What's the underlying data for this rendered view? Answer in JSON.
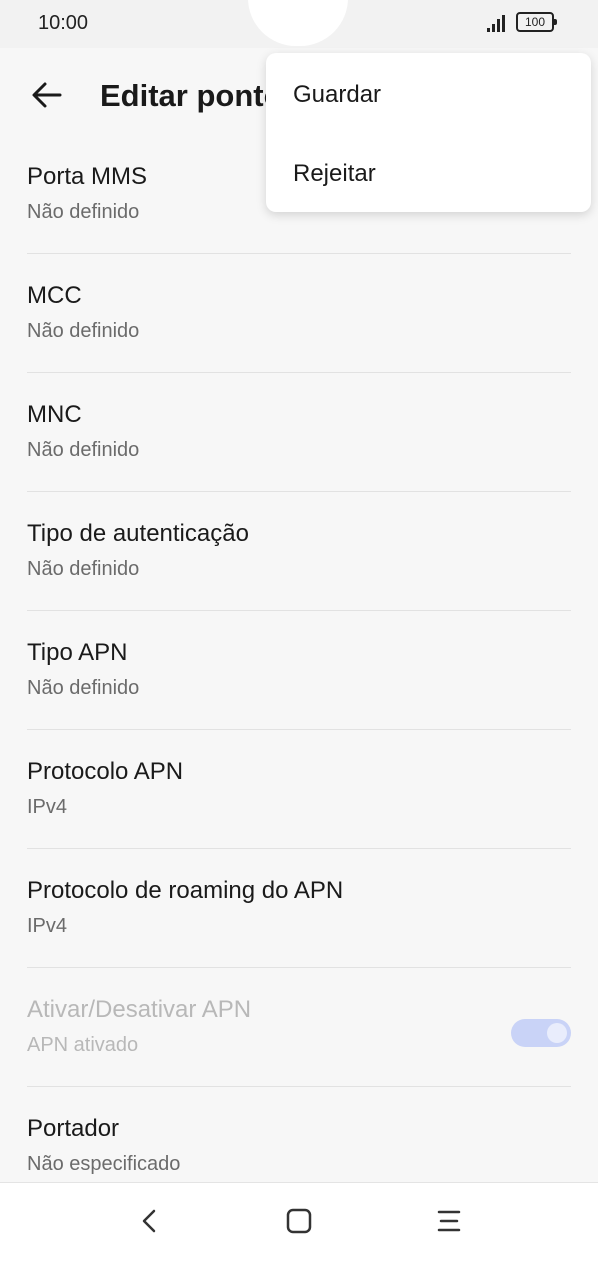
{
  "status_bar": {
    "time": "10:00",
    "battery": "100",
    "signal_icon": "signal-icon",
    "battery_icon": "battery-icon"
  },
  "app_bar": {
    "back_icon": "arrow-left-icon",
    "title": "Editar ponto de acesso"
  },
  "settings": [
    {
      "title": "Porta MMS",
      "value": "Não definido"
    },
    {
      "title": "MCC",
      "value": "Não definido"
    },
    {
      "title": "MNC",
      "value": "Não definido"
    },
    {
      "title": "Tipo de autenticação",
      "value": "Não definido"
    },
    {
      "title": "Tipo APN",
      "value": "Não definido"
    },
    {
      "title": "Protocolo APN",
      "value": "IPv4"
    },
    {
      "title": "Protocolo de roaming do APN",
      "value": "IPv4"
    },
    {
      "title": "Ativar/Desativar APN",
      "value": "APN ativado",
      "toggle": true,
      "toggle_on": true,
      "disabled": true
    },
    {
      "title": "Portador",
      "value": "Não especificado"
    }
  ],
  "overflow_menu": {
    "items": [
      "Guardar",
      "Rejeitar"
    ]
  },
  "nav_bar": {
    "back_icon": "chevron-left-icon",
    "home_icon": "square-home-icon",
    "recents_icon": "menu-lines-icon"
  },
  "colors": {
    "background": "#f7f7f7",
    "toggle_track": "#c9d3f7",
    "divider": "#e2e2e2"
  }
}
